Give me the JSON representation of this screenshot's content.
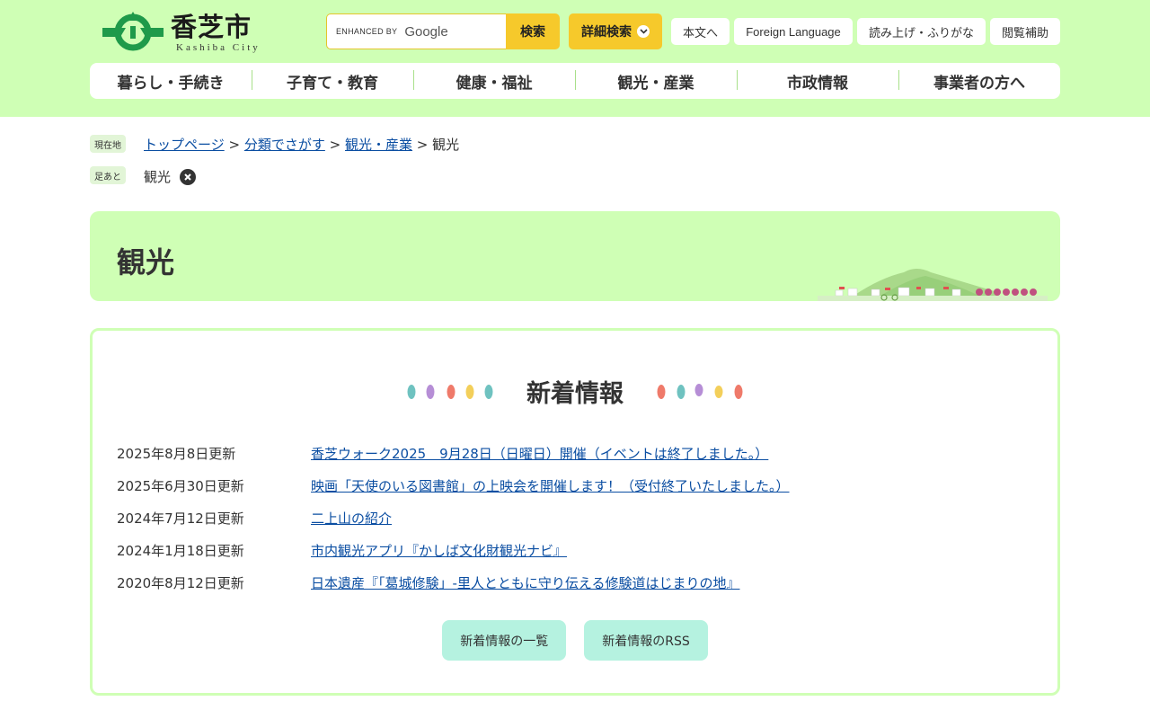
{
  "header": {
    "logo_jp": "香芝市",
    "logo_en": "Kashiba City",
    "search": {
      "enhanced_by": "ENHANCED BY",
      "google": "Google",
      "button": "検索"
    },
    "advanced_search": "詳細検索",
    "utility_links": [
      "本文へ",
      "Foreign Language",
      "読み上げ・ふりがな",
      "閲覧補助"
    ],
    "colors": {
      "header_bg": "#cfffb5",
      "search_button": "#f6c92b",
      "link": "#0b4ea2"
    }
  },
  "global_nav": [
    "暮らし・手続き",
    "子育て・教育",
    "健康・福祉",
    "観光・産業",
    "市政情報",
    "事業者の方へ"
  ],
  "breadcrumb": {
    "label_current": "現在地",
    "items": [
      "トップページ",
      "分類でさがす",
      "観光・産業"
    ],
    "separator": ">",
    "current": "観光",
    "label_footprint": "足あと",
    "footprint": "観光"
  },
  "page_title": "観光",
  "news": {
    "title": "新着情報",
    "items": [
      {
        "date": "2025年8月8日更新",
        "text": "香芝ウォーク2025　9月28日（日曜日）開催（イベントは終了しました。）"
      },
      {
        "date": "2025年6月30日更新",
        "text": "映画「天使のいる図書館」の上映会を開催します！（受付終了いたしました。）"
      },
      {
        "date": "2024年7月12日更新",
        "text": "二上山の紹介"
      },
      {
        "date": "2024年1月18日更新",
        "text": "市内観光アプリ『かしば文化財観光ナビ』"
      },
      {
        "date": "2020年8月12日更新",
        "text": "日本遺産『「葛城修験」-里人とともに守り伝える修験道はじまりの地』"
      }
    ],
    "buttons": [
      "新着情報の一覧",
      "新着情報のRSS"
    ],
    "button_color": "#b5f2e0"
  }
}
